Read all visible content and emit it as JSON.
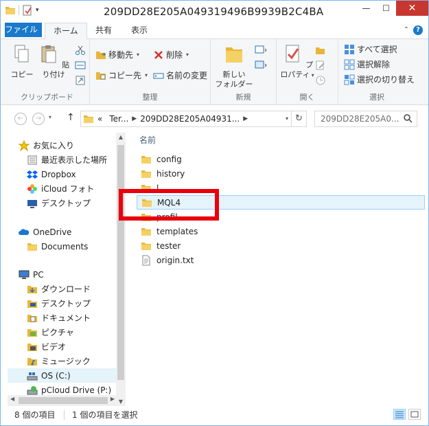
{
  "window": {
    "title": "209DD28E205A049319496B9939B2C4BA",
    "minimize": "—",
    "maximize": "☐",
    "close": "✕"
  },
  "ribbon_tabs": {
    "file": "ファイル",
    "home": "ホーム",
    "share": "共有",
    "view": "表示"
  },
  "ribbon": {
    "clipboard": {
      "label": "クリップボード",
      "copy": "コピー",
      "paste": "貼り付け"
    },
    "organize": {
      "label": "整理",
      "move_to": "移動先",
      "copy_to": "コピー先",
      "delete": "削除",
      "rename": "名前の変更"
    },
    "new": {
      "label": "新規",
      "new_folder_line1": "新しい",
      "new_folder_line2": "フォルダー"
    },
    "open": {
      "label": "開く",
      "properties": "プロパティ"
    },
    "select": {
      "label": "選択",
      "select_all": "すべて選択",
      "select_none": "選択解除",
      "invert": "選択の切り替え"
    }
  },
  "address": {
    "back": "←",
    "forward": "→",
    "up": "↑",
    "overflow": "«",
    "crumb1": "Ter...",
    "crumb2": "209DD28E205A04931...",
    "refresh": "↻",
    "search_placeholder": "209DD28E205A0..."
  },
  "nav": {
    "favorites": "お気に入り",
    "recent": "最近表示した場所",
    "dropbox": "Dropbox",
    "icloud": "iCloud フォト",
    "desktop1": "デスクトップ",
    "onedrive": "OneDrive",
    "documents": "Documents",
    "pc": "PC",
    "downloads": "ダウンロード",
    "desktop2": "デスクトップ",
    "mydocs": "ドキュメント",
    "pictures": "ピクチャ",
    "videos": "ビデオ",
    "music": "ミュージック",
    "osc": "OS (C:)",
    "pcloud": "pCloud Drive (P:)"
  },
  "files": {
    "column_name": "名前",
    "items": [
      {
        "name": "config",
        "type": "folder"
      },
      {
        "name": "history",
        "type": "folder"
      },
      {
        "name": "l",
        "type": "folder"
      },
      {
        "name": "MQL4",
        "type": "folder"
      },
      {
        "name": "profil",
        "type": "folder"
      },
      {
        "name": "templates",
        "type": "folder"
      },
      {
        "name": "tester",
        "type": "folder"
      },
      {
        "name": "origin.txt",
        "type": "text"
      }
    ]
  },
  "status": {
    "count": "8 個の項目",
    "selected": "1 個の項目を選択"
  },
  "colors": {
    "accent": "#1979ca",
    "highlight": "#e8000d",
    "selection": "#e5f3fb",
    "folder": "#f1c950"
  }
}
